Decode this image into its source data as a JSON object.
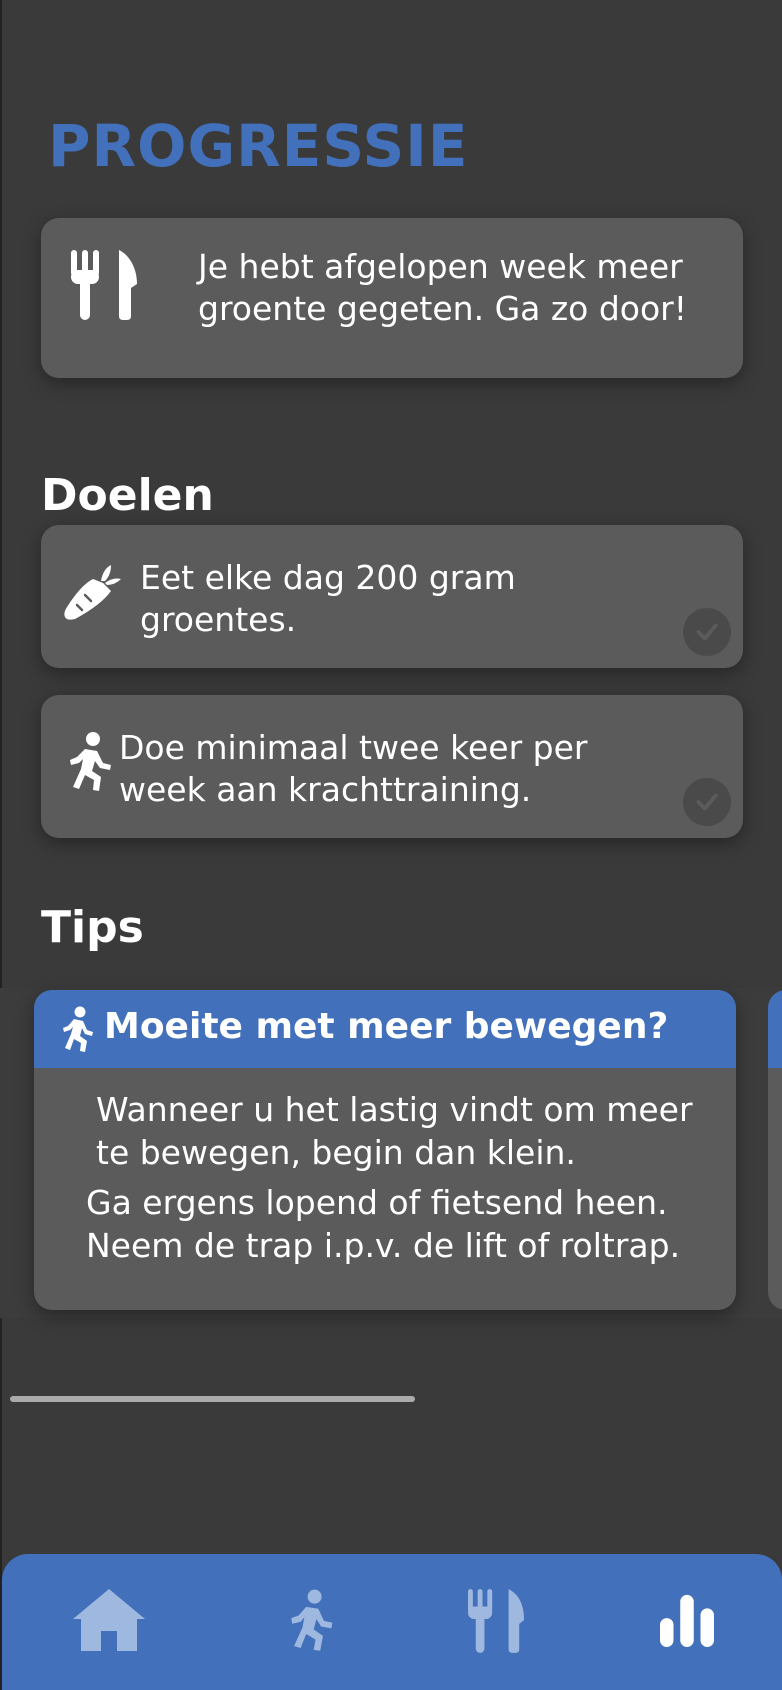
{
  "page": {
    "title": "PROGRESSIE"
  },
  "progress_card": {
    "icon": "cutlery-icon",
    "message": "Je hebt afgelopen week meer groente gegeten. Ga zo door!"
  },
  "goals": {
    "title": "Doelen",
    "items": [
      {
        "icon": "carrot-icon",
        "text": "Eet elke dag 200 gram groentes.",
        "completed": false
      },
      {
        "icon": "running-person-icon",
        "text": "Doe minimaal twee keer per week aan krachttraining.",
        "completed": false
      }
    ]
  },
  "tips": {
    "title": "Tips",
    "cards": [
      {
        "icon": "walking-person-icon",
        "title": "Moeite met meer bewegen?",
        "paragraphs": [
          "Wanneer u het lastig vindt om meer te bewegen, begin dan klein.",
          "Ga ergens lopend of fietsend heen. Neem de trap i.p.v. de lift of roltrap."
        ]
      }
    ]
  },
  "nav": {
    "items": [
      {
        "icon": "home-icon",
        "active": false
      },
      {
        "icon": "running-person-icon",
        "active": false
      },
      {
        "icon": "cutlery-icon",
        "active": false
      },
      {
        "icon": "bar-chart-icon",
        "active": true
      }
    ]
  },
  "colors": {
    "accent": "#4270bb",
    "background": "#3a3a3a",
    "card": "#5c5b5c",
    "nav_inactive_icon": "#9fb8e0",
    "nav_active_icon": "#ffffff"
  }
}
